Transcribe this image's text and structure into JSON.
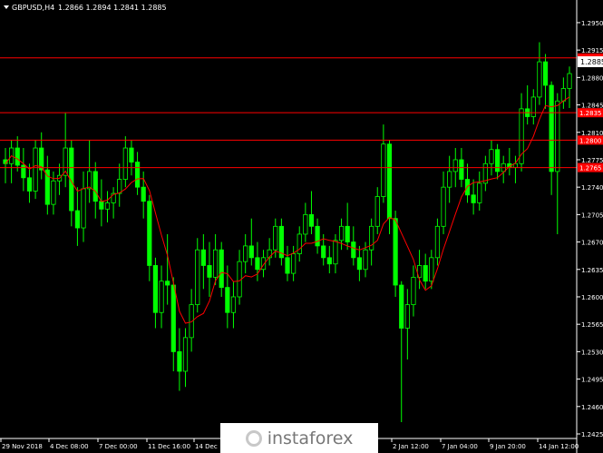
{
  "header": {
    "symbol": "GBPUSD,H4",
    "ohlc": "1.2866 1.2894 1.2841 1.2885"
  },
  "watermark": {
    "text": "instaforex"
  },
  "colors": {
    "background": "#000000",
    "candle": "#00ff00",
    "ma_line": "#ff0000",
    "level_line": "#ff0000",
    "axis_text": "#ffffff",
    "current_box": "#ffffff"
  },
  "chart_data": {
    "type": "candlestick",
    "symbol": "GBPUSD",
    "timeframe": "H4",
    "ylim": [
      1.2425,
      1.2965
    ],
    "yticks": [
      "1.2950",
      "1.2915",
      "1.2880",
      "1.2845",
      "1.2810",
      "1.2775",
      "1.2740",
      "1.2705",
      "1.2670",
      "1.2635",
      "1.2600",
      "1.2565",
      "1.2530",
      "1.2495",
      "1.2460",
      "1.2425"
    ],
    "xticks": [
      "29 Nov 2018",
      "4 Dec 08:00",
      "7 Dec 00:00",
      "11 Dec 16:00",
      "14 Dec",
      "2 Jan 12:00",
      "7 Jan 04:00",
      "9 Jan 20:00",
      "14 Jan 12:00"
    ],
    "current_price": "1.2885",
    "levels": [
      {
        "price": 1.2905,
        "label": "1.2905"
      },
      {
        "price": 1.2835,
        "label": "1.2835"
      },
      {
        "price": 1.28,
        "label": "1.2800"
      },
      {
        "price": 1.2765,
        "label": "1.2765"
      }
    ],
    "moving_average": "red line",
    "candles": [
      [
        1.2775,
        1.279,
        1.2745,
        1.277
      ],
      [
        1.277,
        1.28,
        1.2745,
        1.279
      ],
      [
        1.279,
        1.2805,
        1.276,
        1.2768
      ],
      [
        1.2768,
        1.279,
        1.2735,
        1.2752
      ],
      [
        1.2752,
        1.277,
        1.272,
        1.2735
      ],
      [
        1.2735,
        1.28,
        1.2725,
        1.279
      ],
      [
        1.279,
        1.281,
        1.275,
        1.2762
      ],
      [
        1.2762,
        1.278,
        1.2705,
        1.2718
      ],
      [
        1.2718,
        1.276,
        1.2705,
        1.2748
      ],
      [
        1.2748,
        1.277,
        1.273,
        1.2755
      ],
      [
        1.2755,
        1.2835,
        1.274,
        1.279
      ],
      [
        1.279,
        1.28,
        1.269,
        1.271
      ],
      [
        1.271,
        1.274,
        1.2665,
        1.2688
      ],
      [
        1.2688,
        1.276,
        1.267,
        1.2738
      ],
      [
        1.2738,
        1.28,
        1.272,
        1.276
      ],
      [
        1.276,
        1.2772,
        1.27,
        1.2722
      ],
      [
        1.2722,
        1.275,
        1.269,
        1.2712
      ],
      [
        1.2712,
        1.2735,
        1.2695,
        1.272
      ],
      [
        1.272,
        1.274,
        1.27,
        1.2732
      ],
      [
        1.2732,
        1.277,
        1.2715,
        1.275
      ],
      [
        1.275,
        1.2805,
        1.274,
        1.279
      ],
      [
        1.279,
        1.28,
        1.2755,
        1.2772
      ],
      [
        1.2772,
        1.2785,
        1.273,
        1.274
      ],
      [
        1.274,
        1.276,
        1.27,
        1.2722
      ],
      [
        1.2722,
        1.273,
        1.262,
        1.264
      ],
      [
        1.264,
        1.265,
        1.256,
        1.258
      ],
      [
        1.258,
        1.264,
        1.256,
        1.262
      ],
      [
        1.262,
        1.268,
        1.259,
        1.2615
      ],
      [
        1.2615,
        1.2625,
        1.2505,
        1.253
      ],
      [
        1.253,
        1.256,
        1.248,
        1.2505
      ],
      [
        1.2505,
        1.256,
        1.2485,
        1.2548
      ],
      [
        1.2548,
        1.261,
        1.253,
        1.259
      ],
      [
        1.259,
        1.2675,
        1.258,
        1.266
      ],
      [
        1.266,
        1.268,
        1.261,
        1.264
      ],
      [
        1.264,
        1.267,
        1.26,
        1.2625
      ],
      [
        1.2625,
        1.268,
        1.2615,
        1.266
      ],
      [
        1.266,
        1.267,
        1.26,
        1.2612
      ],
      [
        1.2612,
        1.264,
        1.256,
        1.258
      ],
      [
        1.258,
        1.262,
        1.256,
        1.26
      ],
      [
        1.26,
        1.266,
        1.259,
        1.2645
      ],
      [
        1.2645,
        1.268,
        1.263,
        1.2665
      ],
      [
        1.2665,
        1.27,
        1.264,
        1.265
      ],
      [
        1.265,
        1.267,
        1.262,
        1.2635
      ],
      [
        1.2635,
        1.266,
        1.2625,
        1.265
      ],
      [
        1.265,
        1.2675,
        1.264,
        1.266
      ],
      [
        1.266,
        1.27,
        1.265,
        1.269
      ],
      [
        1.269,
        1.27,
        1.264,
        1.265
      ],
      [
        1.265,
        1.2665,
        1.262,
        1.263
      ],
      [
        1.263,
        1.2665,
        1.262,
        1.2655
      ],
      [
        1.2655,
        1.269,
        1.2645,
        1.268
      ],
      [
        1.268,
        1.272,
        1.267,
        1.2705
      ],
      [
        1.2705,
        1.2735,
        1.268,
        1.269
      ],
      [
        1.269,
        1.27,
        1.2655,
        1.2665
      ],
      [
        1.2665,
        1.268,
        1.264,
        1.265
      ],
      [
        1.265,
        1.2665,
        1.263,
        1.2642
      ],
      [
        1.2642,
        1.268,
        1.263,
        1.2672
      ],
      [
        1.2672,
        1.27,
        1.266,
        1.269
      ],
      [
        1.269,
        1.272,
        1.266,
        1.267
      ],
      [
        1.267,
        1.269,
        1.264,
        1.265
      ],
      [
        1.265,
        1.2665,
        1.262,
        1.2635
      ],
      [
        1.2635,
        1.267,
        1.2625,
        1.266
      ],
      [
        1.266,
        1.27,
        1.264,
        1.269
      ],
      [
        1.269,
        1.274,
        1.268,
        1.2728
      ],
      [
        1.2728,
        1.282,
        1.272,
        1.2795
      ],
      [
        1.2795,
        1.28,
        1.268,
        1.27
      ],
      [
        1.27,
        1.271,
        1.26,
        1.2615
      ],
      [
        1.2615,
        1.262,
        1.244,
        1.256
      ],
      [
        1.256,
        1.261,
        1.252,
        1.259
      ],
      [
        1.259,
        1.264,
        1.2575,
        1.2625
      ],
      [
        1.2625,
        1.266,
        1.261,
        1.264
      ],
      [
        1.264,
        1.2655,
        1.261,
        1.262
      ],
      [
        1.262,
        1.266,
        1.261,
        1.265
      ],
      [
        1.265,
        1.27,
        1.264,
        1.269
      ],
      [
        1.269,
        1.276,
        1.268,
        1.274
      ],
      [
        1.274,
        1.278,
        1.272,
        1.276
      ],
      [
        1.276,
        1.279,
        1.274,
        1.2775
      ],
      [
        1.2775,
        1.279,
        1.274,
        1.275
      ],
      [
        1.275,
        1.277,
        1.272,
        1.273
      ],
      [
        1.273,
        1.275,
        1.2705,
        1.272
      ],
      [
        1.272,
        1.276,
        1.271,
        1.2745
      ],
      [
        1.2745,
        1.278,
        1.2735,
        1.277
      ],
      [
        1.277,
        1.28,
        1.2755,
        1.2788
      ],
      [
        1.2788,
        1.2795,
        1.275,
        1.276
      ],
      [
        1.276,
        1.278,
        1.2745,
        1.277
      ],
      [
        1.277,
        1.279,
        1.2755,
        1.2765
      ],
      [
        1.2765,
        1.278,
        1.2745,
        1.277
      ],
      [
        1.277,
        1.286,
        1.276,
        1.284
      ],
      [
        1.284,
        1.287,
        1.282,
        1.283
      ],
      [
        1.283,
        1.2865,
        1.282,
        1.2855
      ],
      [
        1.2855,
        1.2925,
        1.2845,
        1.29
      ],
      [
        1.29,
        1.291,
        1.284,
        1.287
      ],
      [
        1.287,
        1.2875,
        1.273,
        1.276
      ],
      [
        1.276,
        1.286,
        1.268,
        1.285
      ],
      [
        1.285,
        1.288,
        1.284,
        1.2866
      ],
      [
        1.2866,
        1.2894,
        1.2841,
        1.2885
      ]
    ]
  }
}
